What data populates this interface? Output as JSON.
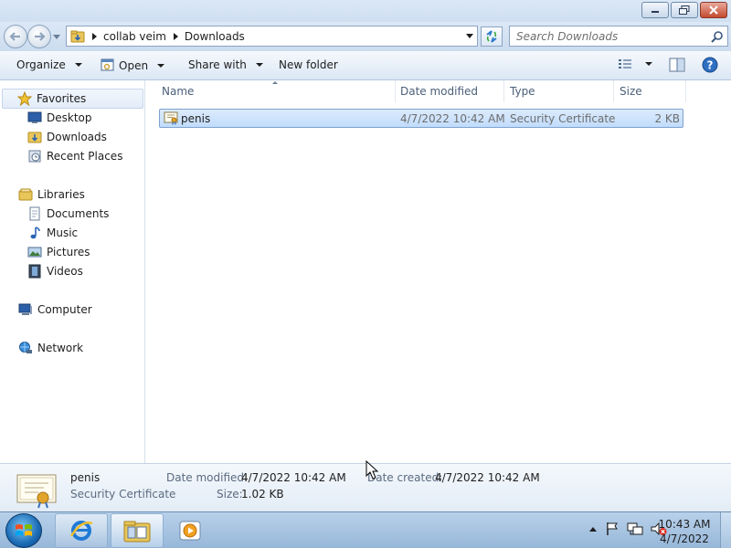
{
  "address_bar": {
    "crumbs": [
      "collab veim",
      "Downloads"
    ]
  },
  "search": {
    "placeholder": "Search Downloads"
  },
  "toolbar": {
    "organize_label": "Organize",
    "open_label": "Open",
    "share_label": "Share with",
    "new_folder_label": "New folder"
  },
  "sidebar": {
    "favorites": {
      "label": "Favorites",
      "items": [
        {
          "label": "Desktop",
          "icon": "desktop-icon"
        },
        {
          "label": "Downloads",
          "icon": "downloads-folder-icon"
        },
        {
          "label": "Recent Places",
          "icon": "recent-places-icon"
        }
      ]
    },
    "libraries": {
      "label": "Libraries",
      "items": [
        {
          "label": "Documents",
          "icon": "documents-icon"
        },
        {
          "label": "Music",
          "icon": "music-icon"
        },
        {
          "label": "Pictures",
          "icon": "pictures-icon"
        },
        {
          "label": "Videos",
          "icon": "videos-icon"
        }
      ]
    },
    "computer_label": "Computer",
    "network_label": "Network"
  },
  "file_list": {
    "columns": [
      "Name",
      "Date modified",
      "Type",
      "Size"
    ],
    "rows": [
      {
        "name": "penis",
        "date_modified": "4/7/2022 10:42 AM",
        "type": "Security Certificate",
        "size": "2 KB",
        "icon": "certificate-icon",
        "selected": true
      }
    ]
  },
  "details_pane": {
    "name": "penis",
    "type": "Security Certificate",
    "date_modified_label": "Date modified:",
    "date_modified": "4/7/2022 10:42 AM",
    "size_label": "Size:",
    "size": "1.02 KB",
    "date_created_label": "Date created:",
    "date_created": "4/7/2022 10:42 AM"
  },
  "taskbar": {
    "pinned": [
      "internet-explorer-icon",
      "windows-explorer-icon",
      "media-player-icon"
    ],
    "clock_time": "10:43 AM",
    "clock_date": "4/7/2022"
  },
  "colors": {
    "selection_bg": "#c9e0fc",
    "selection_border": "#7da2ce",
    "chrome": "#cfdff1"
  }
}
